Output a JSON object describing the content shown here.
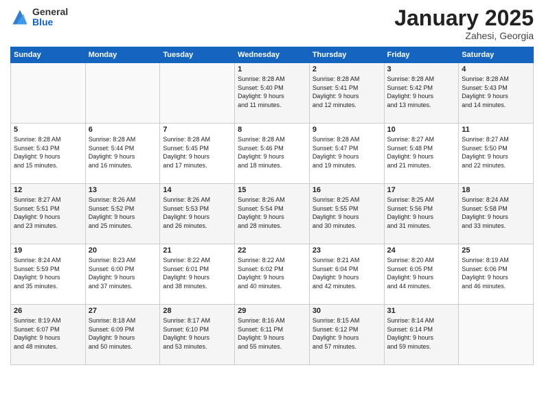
{
  "logo": {
    "general": "General",
    "blue": "Blue"
  },
  "title": "January 2025",
  "location": "Zahesi, Georgia",
  "days": [
    "Sunday",
    "Monday",
    "Tuesday",
    "Wednesday",
    "Thursday",
    "Friday",
    "Saturday"
  ],
  "weeks": [
    [
      {
        "day": "",
        "content": ""
      },
      {
        "day": "",
        "content": ""
      },
      {
        "day": "",
        "content": ""
      },
      {
        "day": "1",
        "content": "Sunrise: 8:28 AM\nSunset: 5:40 PM\nDaylight: 9 hours\nand 11 minutes."
      },
      {
        "day": "2",
        "content": "Sunrise: 8:28 AM\nSunset: 5:41 PM\nDaylight: 9 hours\nand 12 minutes."
      },
      {
        "day": "3",
        "content": "Sunrise: 8:28 AM\nSunset: 5:42 PM\nDaylight: 9 hours\nand 13 minutes."
      },
      {
        "day": "4",
        "content": "Sunrise: 8:28 AM\nSunset: 5:43 PM\nDaylight: 9 hours\nand 14 minutes."
      }
    ],
    [
      {
        "day": "5",
        "content": "Sunrise: 8:28 AM\nSunset: 5:43 PM\nDaylight: 9 hours\nand 15 minutes."
      },
      {
        "day": "6",
        "content": "Sunrise: 8:28 AM\nSunset: 5:44 PM\nDaylight: 9 hours\nand 16 minutes."
      },
      {
        "day": "7",
        "content": "Sunrise: 8:28 AM\nSunset: 5:45 PM\nDaylight: 9 hours\nand 17 minutes."
      },
      {
        "day": "8",
        "content": "Sunrise: 8:28 AM\nSunset: 5:46 PM\nDaylight: 9 hours\nand 18 minutes."
      },
      {
        "day": "9",
        "content": "Sunrise: 8:28 AM\nSunset: 5:47 PM\nDaylight: 9 hours\nand 19 minutes."
      },
      {
        "day": "10",
        "content": "Sunrise: 8:27 AM\nSunset: 5:48 PM\nDaylight: 9 hours\nand 21 minutes."
      },
      {
        "day": "11",
        "content": "Sunrise: 8:27 AM\nSunset: 5:50 PM\nDaylight: 9 hours\nand 22 minutes."
      }
    ],
    [
      {
        "day": "12",
        "content": "Sunrise: 8:27 AM\nSunset: 5:51 PM\nDaylight: 9 hours\nand 23 minutes."
      },
      {
        "day": "13",
        "content": "Sunrise: 8:26 AM\nSunset: 5:52 PM\nDaylight: 9 hours\nand 25 minutes."
      },
      {
        "day": "14",
        "content": "Sunrise: 8:26 AM\nSunset: 5:53 PM\nDaylight: 9 hours\nand 26 minutes."
      },
      {
        "day": "15",
        "content": "Sunrise: 8:26 AM\nSunset: 5:54 PM\nDaylight: 9 hours\nand 28 minutes."
      },
      {
        "day": "16",
        "content": "Sunrise: 8:25 AM\nSunset: 5:55 PM\nDaylight: 9 hours\nand 30 minutes."
      },
      {
        "day": "17",
        "content": "Sunrise: 8:25 AM\nSunset: 5:56 PM\nDaylight: 9 hours\nand 31 minutes."
      },
      {
        "day": "18",
        "content": "Sunrise: 8:24 AM\nSunset: 5:58 PM\nDaylight: 9 hours\nand 33 minutes."
      }
    ],
    [
      {
        "day": "19",
        "content": "Sunrise: 8:24 AM\nSunset: 5:59 PM\nDaylight: 9 hours\nand 35 minutes."
      },
      {
        "day": "20",
        "content": "Sunrise: 8:23 AM\nSunset: 6:00 PM\nDaylight: 9 hours\nand 37 minutes."
      },
      {
        "day": "21",
        "content": "Sunrise: 8:22 AM\nSunset: 6:01 PM\nDaylight: 9 hours\nand 38 minutes."
      },
      {
        "day": "22",
        "content": "Sunrise: 8:22 AM\nSunset: 6:02 PM\nDaylight: 9 hours\nand 40 minutes."
      },
      {
        "day": "23",
        "content": "Sunrise: 8:21 AM\nSunset: 6:04 PM\nDaylight: 9 hours\nand 42 minutes."
      },
      {
        "day": "24",
        "content": "Sunrise: 8:20 AM\nSunset: 6:05 PM\nDaylight: 9 hours\nand 44 minutes."
      },
      {
        "day": "25",
        "content": "Sunrise: 8:19 AM\nSunset: 6:06 PM\nDaylight: 9 hours\nand 46 minutes."
      }
    ],
    [
      {
        "day": "26",
        "content": "Sunrise: 8:19 AM\nSunset: 6:07 PM\nDaylight: 9 hours\nand 48 minutes."
      },
      {
        "day": "27",
        "content": "Sunrise: 8:18 AM\nSunset: 6:09 PM\nDaylight: 9 hours\nand 50 minutes."
      },
      {
        "day": "28",
        "content": "Sunrise: 8:17 AM\nSunset: 6:10 PM\nDaylight: 9 hours\nand 53 minutes."
      },
      {
        "day": "29",
        "content": "Sunrise: 8:16 AM\nSunset: 6:11 PM\nDaylight: 9 hours\nand 55 minutes."
      },
      {
        "day": "30",
        "content": "Sunrise: 8:15 AM\nSunset: 6:12 PM\nDaylight: 9 hours\nand 57 minutes."
      },
      {
        "day": "31",
        "content": "Sunrise: 8:14 AM\nSunset: 6:14 PM\nDaylight: 9 hours\nand 59 minutes."
      },
      {
        "day": "",
        "content": ""
      }
    ]
  ]
}
